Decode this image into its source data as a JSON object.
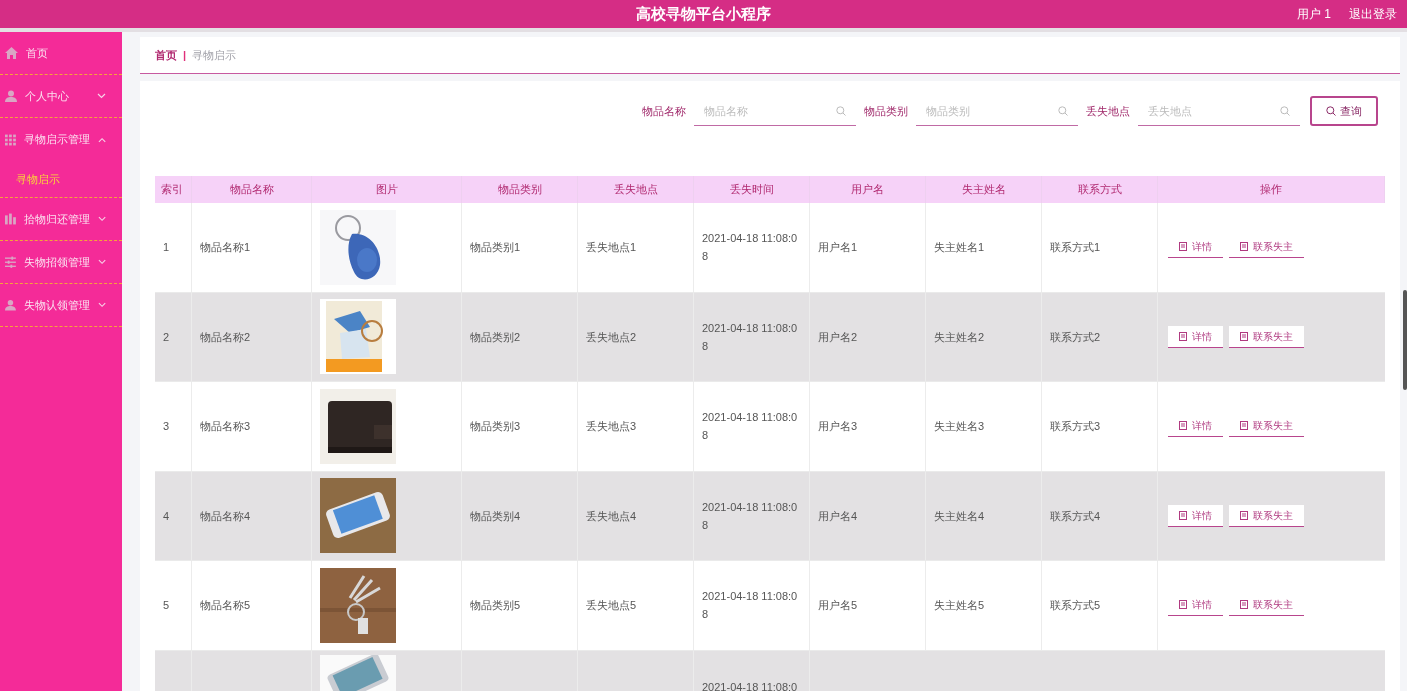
{
  "header": {
    "title": "高校寻物平台小程序",
    "user": "用户 1",
    "logout": "退出登录"
  },
  "sidebar": {
    "items": [
      {
        "label": "首页"
      },
      {
        "label": "个人中心",
        "expanded": false
      },
      {
        "label": "寻物启示管理",
        "expanded": true,
        "children": [
          {
            "label": "寻物启示",
            "selected": true
          }
        ]
      },
      {
        "label": "拾物归还管理",
        "expanded": false
      },
      {
        "label": "失物招领管理",
        "expanded": false
      },
      {
        "label": "失物认领管理",
        "expanded": false
      }
    ]
  },
  "breadcrumb": {
    "items": [
      "首页",
      "寻物启示"
    ],
    "separator": "|"
  },
  "search": {
    "fields": [
      {
        "label": "物品名称",
        "placeholder": "物品名称"
      },
      {
        "label": "物品类别",
        "placeholder": "物品类别"
      },
      {
        "label": "丢失地点",
        "placeholder": "丢失地点"
      }
    ],
    "button": "查询"
  },
  "table": {
    "columns": [
      "索引",
      "物品名称",
      "图片",
      "物品类别",
      "丢失地点",
      "丢失时间",
      "用户名",
      "失主姓名",
      "联系方式",
      "操作"
    ],
    "rows": [
      {
        "index": "1",
        "name": "物品名称1",
        "category": "物品类别1",
        "place": "丢失地点1",
        "time": "2021-04-18 11:08:08",
        "user": "用户名1",
        "owner": "失主姓名1",
        "contact": "联系方式1",
        "actions": [
          "详情",
          "联系失主"
        ]
      },
      {
        "index": "2",
        "name": "物品名称2",
        "category": "物品类别2",
        "place": "丢失地点2",
        "time": "2021-04-18 11:08:08",
        "user": "用户名2",
        "owner": "失主姓名2",
        "contact": "联系方式2",
        "actions": [
          "详情",
          "联系失主"
        ]
      },
      {
        "index": "3",
        "name": "物品名称3",
        "category": "物品类别3",
        "place": "丢失地点3",
        "time": "2021-04-18 11:08:08",
        "user": "用户名3",
        "owner": "失主姓名3",
        "contact": "联系方式3",
        "actions": [
          "详情",
          "联系失主"
        ]
      },
      {
        "index": "4",
        "name": "物品名称4",
        "category": "物品类别4",
        "place": "丢失地点4",
        "time": "2021-04-18 11:08:08",
        "user": "用户名4",
        "owner": "失主姓名4",
        "contact": "联系方式4",
        "actions": [
          "详情",
          "联系失主"
        ]
      },
      {
        "index": "5",
        "name": "物品名称5",
        "category": "物品类别5",
        "place": "丢失地点5",
        "time": "2021-04-18 11:08:08",
        "user": "用户名5",
        "owner": "失主姓名5",
        "contact": "联系方式5",
        "actions": [
          "详情",
          "联系失主"
        ]
      }
    ],
    "partial_row": {
      "time": "2021-04-18 11:08:0"
    }
  }
}
